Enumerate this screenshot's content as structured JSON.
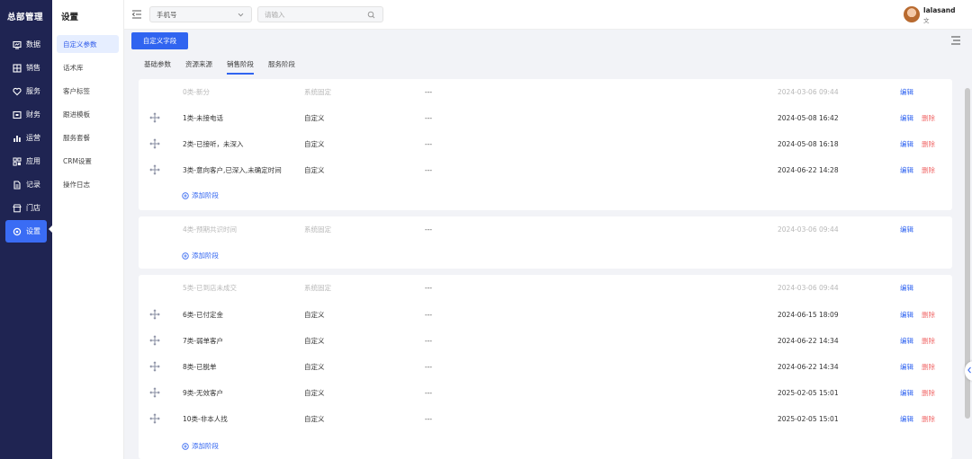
{
  "app": {
    "title": "总部管理"
  },
  "nav": {
    "items": [
      {
        "label": "数据",
        "icon": "data-icon"
      },
      {
        "label": "销售",
        "icon": "sales-icon"
      },
      {
        "label": "服务",
        "icon": "heart-icon"
      },
      {
        "label": "财务",
        "icon": "finance-icon"
      },
      {
        "label": "运营",
        "icon": "bar-chart-icon"
      },
      {
        "label": "应用",
        "icon": "apps-icon"
      },
      {
        "label": "记录",
        "icon": "document-icon"
      },
      {
        "label": "门店",
        "icon": "store-icon"
      },
      {
        "label": "设置",
        "icon": "settings-icon",
        "active": true
      }
    ]
  },
  "settings": {
    "title": "设置",
    "items": [
      "自定义参数",
      "话术库",
      "客户标签",
      "跟进模板",
      "服务套餐",
      "CRM设置",
      "操作日志"
    ]
  },
  "topbar": {
    "select_value": "手机号",
    "search_placeholder": "请输入",
    "user_name": "lalasand",
    "user_sub": "文"
  },
  "toolbar": {
    "custom_field_label": "自定义字段"
  },
  "tabs": [
    "基础参数",
    "资源来源",
    "销售阶段",
    "服务阶段"
  ],
  "actions": {
    "edit": "编辑",
    "delete": "删除",
    "add_stage": "添加阶段"
  },
  "groups": [
    {
      "rows": [
        {
          "name": "0类-新分",
          "type": "系统固定",
          "dash": "---",
          "time": "2024-03-06 09:44",
          "fixed": true
        },
        {
          "name": "1类-未接电话",
          "type": "自定义",
          "dash": "---",
          "time": "2024-05-08 16:42"
        },
        {
          "name": "2类-已接听，未深入",
          "type": "自定义",
          "dash": "---",
          "time": "2024-05-08 16:18"
        },
        {
          "name": "3类-意向客户,已深入,未确定时间",
          "type": "自定义",
          "dash": "---",
          "time": "2024-06-22 14:28"
        }
      ]
    },
    {
      "rows": [
        {
          "name": "4类-预期共识时间",
          "type": "系统固定",
          "dash": "---",
          "time": "2024-03-06 09:44",
          "fixed": true
        }
      ]
    },
    {
      "rows": [
        {
          "name": "5类-已到店未成交",
          "type": "系统固定",
          "dash": "---",
          "time": "2024-03-06 09:44",
          "fixed": true
        },
        {
          "name": "6类-已付定金",
          "type": "自定义",
          "dash": "---",
          "time": "2024-06-15 18:09"
        },
        {
          "name": "7类-弱单客户",
          "type": "自定义",
          "dash": "---",
          "time": "2024-06-22 14:34"
        },
        {
          "name": "8类-已脱单",
          "type": "自定义",
          "dash": "---",
          "time": "2024-06-22 14:34"
        },
        {
          "name": "9类-无效客户",
          "type": "自定义",
          "dash": "---",
          "time": "2025-02-05 15:01"
        },
        {
          "name": "10类-非本人找",
          "type": "自定义",
          "dash": "---",
          "time": "2025-02-05 15:01"
        }
      ]
    }
  ]
}
